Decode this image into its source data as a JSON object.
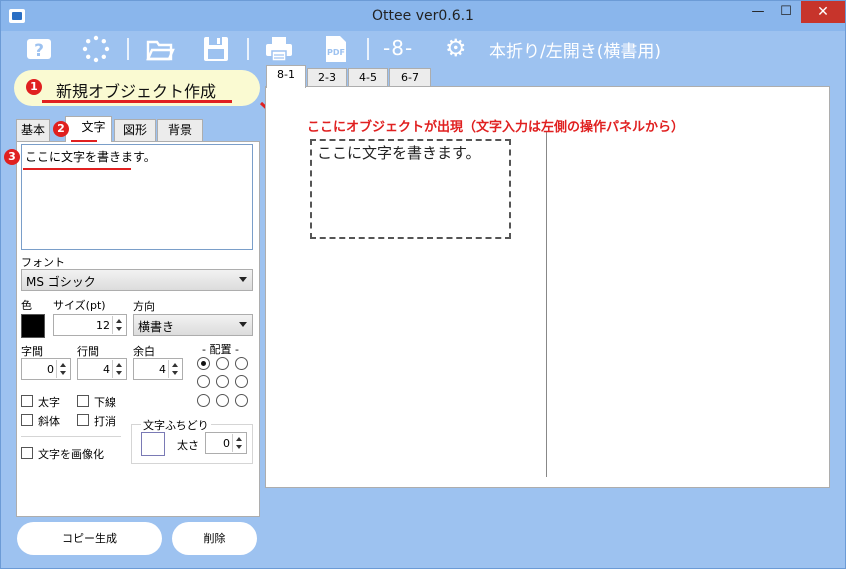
{
  "window": {
    "title": "Ottee ver0.6.1",
    "minimize": "—",
    "maximize": "☐",
    "close": "✕"
  },
  "toolbar": {
    "page_indicator": "-8-",
    "layout_mode": "本折り/左開き(横書用)",
    "pdf_label": "PDF"
  },
  "new_object": {
    "badge": "1",
    "label": "新規オブジェクト作成"
  },
  "left_panel": {
    "tabs": [
      {
        "label": "基本"
      },
      {
        "label": "文字",
        "badge": "2"
      },
      {
        "label": "図形"
      },
      {
        "label": "背景"
      }
    ],
    "text_badge": "3",
    "text_value": "ここに文字を書きます。",
    "font_label": "フォント",
    "font_value": "MS ゴシック",
    "color_label": "色",
    "size_label": "サイズ(pt)",
    "size_value": "12",
    "direction_label": "方向",
    "direction_value": "横書き",
    "char_spacing_label": "字間",
    "char_spacing_value": "0",
    "line_spacing_label": "行間",
    "line_spacing_value": "4",
    "margin_label": "余白",
    "margin_value": "4",
    "alignment_label": "- 配置 -",
    "bold_label": "太字",
    "underline_label": "下線",
    "italic_label": "斜体",
    "strike_label": "打消",
    "rasterize_label": "文字を画像化",
    "fringe_label": "文字ふちどり",
    "fringe_thickness_label": "太さ",
    "fringe_thickness_value": "0"
  },
  "buttons": {
    "copy_create": "コピー生成",
    "delete": "削除"
  },
  "page_tabs": [
    "8-1",
    "2-3",
    "4-5",
    "6-7"
  ],
  "canvas": {
    "annotation": "ここにオブジェクトが出現（文字入力は左側の操作パネルから）",
    "object_text": "ここに文字を書きます。"
  },
  "colors": {
    "accent_red": "#e02020",
    "window_blue": "#9dc2f0",
    "close_red": "#c7342b",
    "highlight_yellow": "#fafad2"
  }
}
